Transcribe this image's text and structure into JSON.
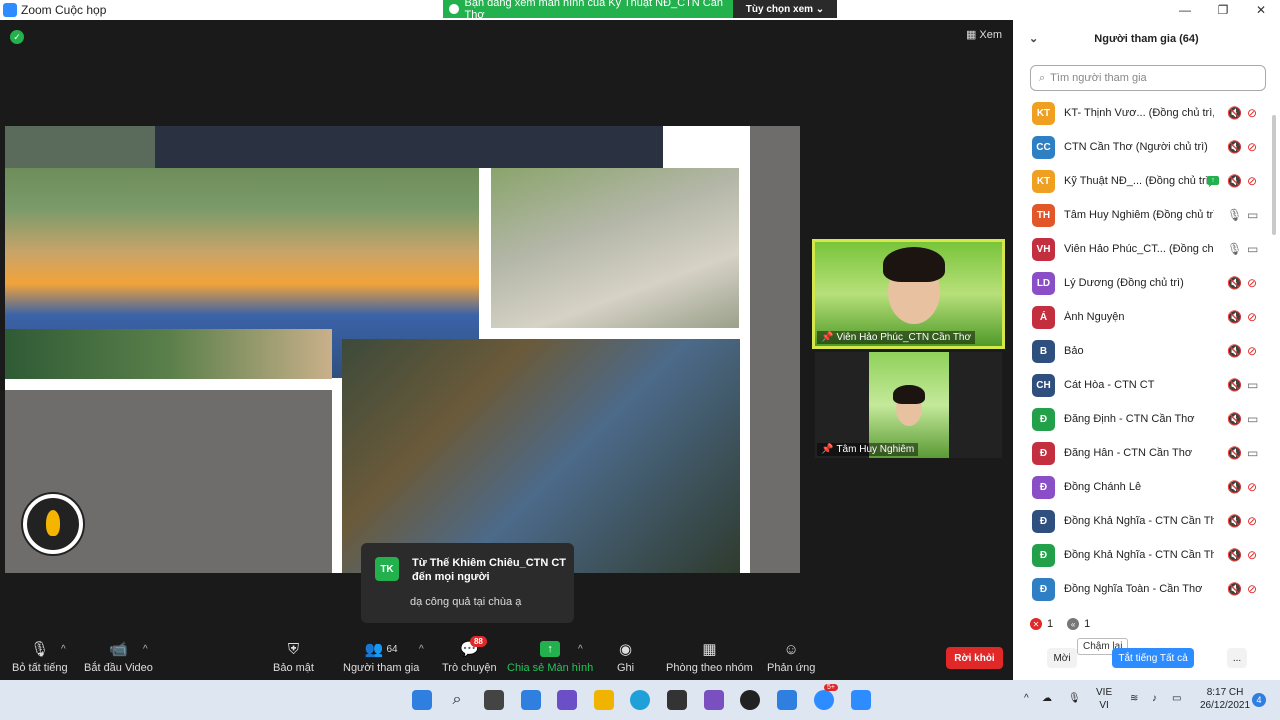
{
  "window": {
    "title": "Zoom Cuộc họp",
    "minimize": "—",
    "maximize": "❐",
    "close": "✕"
  },
  "share_banner": {
    "text": "Bạn đang xem màn hình của Kỹ Thuật NĐ_CTN Cần Thơ",
    "options_label": "Tùy chọn xem ⌄"
  },
  "stage": {
    "view_label": "Xem"
  },
  "videos": [
    {
      "name": "Viên Hảo Phúc_CTN Cần Thơ"
    },
    {
      "name": "Tâm Huy Nghiêm"
    }
  ],
  "chat_toast": {
    "avatar": "TK",
    "sender": "Từ Thế Khiêm Chiêu_CTN CT đến mọi người",
    "message": "dạ công quả tại chùa ạ"
  },
  "toolbar": {
    "mute": "Bỏ tất tiếng",
    "video": "Bắt đầu Video",
    "security": "Bảo mật",
    "participants": "Người tham gia",
    "participants_count": "64",
    "chat": "Trò chuyện",
    "chat_badge": "88",
    "share": "Chia sẻ Màn hình",
    "record": "Ghi",
    "breakout": "Phòng theo nhóm",
    "reactions": "Phản ứng",
    "leave": "Rời khỏi"
  },
  "panel": {
    "title": "Người tham gia (64)",
    "search_placeholder": "Tìm người tham gia",
    "participants": [
      {
        "initials": "KT",
        "name": "KT- Thịnh Vươ... (Đồng chủ trì, tôi)",
        "color": "#f0a020",
        "mic": "off",
        "cam": "off",
        "sharing": false
      },
      {
        "initials": "CC",
        "name": "CTN Cần Thơ (Người chủ trì)",
        "color": "#2f7fc4",
        "mic": "off",
        "cam": "off",
        "sharing": false
      },
      {
        "initials": "KT",
        "name": "Kỹ Thuật NĐ_... (Đồng chủ trì)",
        "color": "#f0a020",
        "mic": "off",
        "cam": "off",
        "sharing": true
      },
      {
        "initials": "TH",
        "name": "Tâm Huy Nghiêm (Đồng chủ trì)",
        "color": "#e2572a",
        "mic": "on",
        "cam": "on",
        "sharing": false
      },
      {
        "initials": "VH",
        "name": "Viên Hảo Phúc_CT... (Đồng chủ trì)",
        "color": "#c42f3f",
        "mic": "on",
        "cam": "on",
        "sharing": false
      },
      {
        "initials": "LD",
        "name": "Lý Dương (Đồng chủ trì)",
        "color": "#8a4fc7",
        "mic": "off",
        "cam": "off",
        "sharing": false
      },
      {
        "initials": "Á",
        "name": "Ánh Nguyện",
        "color": "#c42f3f",
        "mic": "off",
        "cam": "off",
        "sharing": false
      },
      {
        "initials": "B",
        "name": "Bảo",
        "color": "#2f4f7e",
        "mic": "off",
        "cam": "off",
        "sharing": false
      },
      {
        "initials": "CH",
        "name": "Cát Hòa - CTN CT",
        "color": "#2f4f7e",
        "mic": "off",
        "cam": "on",
        "sharing": false
      },
      {
        "initials": "Đ",
        "name": "Đăng Định - CTN Cần Thơ",
        "color": "#23a04a",
        "mic": "off",
        "cam": "on",
        "sharing": false
      },
      {
        "initials": "Đ",
        "name": "Đăng Hân - CTN Cần Thơ",
        "color": "#c42f3f",
        "mic": "off",
        "cam": "on",
        "sharing": false
      },
      {
        "initials": "Đ",
        "name": "Đồng Chánh Lễ",
        "color": "#8a4fc7",
        "mic": "off",
        "cam": "off",
        "sharing": false
      },
      {
        "initials": "Đ",
        "name": "Đồng Khả Nghĩa - CTN Cần Thơ",
        "color": "#2f4f7e",
        "mic": "off",
        "cam": "off",
        "sharing": false
      },
      {
        "initials": "Đ",
        "name": "Đồng Khả Nghĩa - CTN Cần Thơ (...",
        "color": "#23a04a",
        "mic": "off",
        "cam": "off",
        "sharing": false
      },
      {
        "initials": "Đ",
        "name": "Đồng Nghĩa Toàn - Cần Thơ",
        "color": "#2f7fc4",
        "mic": "off",
        "cam": "off",
        "sharing": false
      }
    ],
    "reaction_no": "1",
    "reaction_slow": "1",
    "tooltip": "Chậm lại",
    "invite": "Mời",
    "mute_all": "Tắt tiếng Tất cả",
    "more": "..."
  },
  "taskbar": {
    "lang_top": "VIE",
    "lang_bottom": "VI",
    "time": "8:17 CH",
    "date": "26/12/2021",
    "notif": "4",
    "zalo_badge": "5+"
  }
}
